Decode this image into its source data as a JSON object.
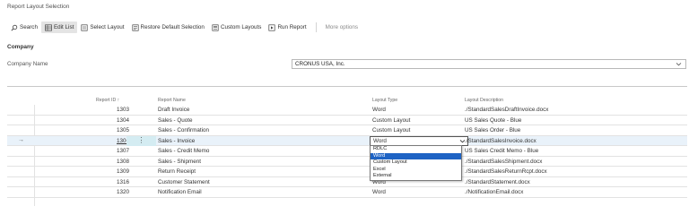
{
  "page": {
    "title": "Report Layout Selection"
  },
  "toolbar": {
    "search": "Search",
    "edit_list": "Edit List",
    "select_layout": "Select Layout",
    "restore_default": "Restore Default Selection",
    "custom_layouts": "Custom Layouts",
    "run_report": "Run Report",
    "more_options": "More options"
  },
  "company": {
    "section_label": "Company",
    "field_label": "Company Name",
    "field_value": "CRONUS USA, Inc."
  },
  "grid": {
    "headers": {
      "report_id": "Report ID",
      "report_id_sort": "↑",
      "report_name": "Report Name",
      "layout_type": "Layout Type",
      "layout_description": "Layout Description"
    },
    "rows": [
      {
        "id": "1303",
        "name": "Draft Invoice",
        "type": "Word",
        "desc": "./StandardSalesDraftInvoice.docx"
      },
      {
        "id": "1304",
        "name": "Sales - Quote",
        "type": "Custom Layout",
        "desc": "US Sales Quote - Blue"
      },
      {
        "id": "1305",
        "name": "Sales - Confirmation",
        "type": "Custom Layout",
        "desc": "US Sales Order - Blue"
      },
      {
        "id": "1306",
        "name": "Sales - Invoice",
        "type": "Word",
        "desc": "./StandardSalesInvoice.docx"
      },
      {
        "id": "1307",
        "name": "Sales - Credit Memo",
        "type": "Custom Layout",
        "desc": "US Sales Credit Memo - Blue"
      },
      {
        "id": "1308",
        "name": "Sales - Shipment",
        "type": "Word",
        "desc": "./StandardSalesShipment.docx"
      },
      {
        "id": "1309",
        "name": "Return Receipt",
        "type": "Word",
        "desc": "./StandardSalesReturnRcpt.docx"
      },
      {
        "id": "1316",
        "name": "Customer Statement",
        "type": "Word",
        "desc": "./StandardStatement.docx"
      },
      {
        "id": "1320",
        "name": "Notification Email",
        "type": "Word",
        "desc": "./NotificationEmail.docx"
      }
    ],
    "selected_row_index": 3,
    "selected_row_arrow": "→",
    "ellipsis": "⋮"
  },
  "dropdown": {
    "options": [
      "RDLC",
      "Word",
      "Custom Layout",
      "Excel",
      "External"
    ],
    "selected": "Word"
  },
  "colors": {
    "selection_blue": "#1e63c4",
    "selected_row_bg": "#e9f2fa",
    "ellipsis_cell_bg": "#d4ecf2"
  },
  "icons": [
    "search-icon",
    "edit-list-icon",
    "select-layout-icon",
    "restore-icon",
    "custom-layouts-icon",
    "run-report-icon",
    "chevron-down-icon"
  ]
}
